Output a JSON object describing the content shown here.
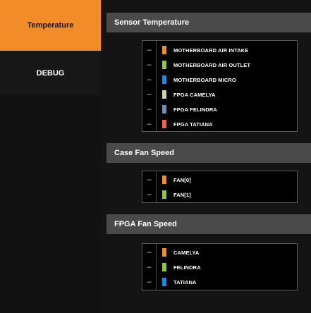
{
  "sidebar": {
    "items": [
      {
        "label": "Temperature"
      },
      {
        "label": "DEBUG"
      }
    ]
  },
  "sections": [
    {
      "title": "Sensor Temperature",
      "items": [
        {
          "label": "MOTHERBOARD AIR INTAKE",
          "color": "#f28c28",
          "toggle": "–"
        },
        {
          "label": "MOTHERBOARD AIR OUTLET",
          "color": "#8dc63f",
          "toggle": "–"
        },
        {
          "label": "MOTHERBOARD MICRO",
          "color": "#1e88e5",
          "toggle": "–"
        },
        {
          "label": "FPGA CAMELYA",
          "color": "#c9d6a0",
          "toggle": "–"
        },
        {
          "label": "FPGA FELINDRA",
          "color": "#6e8fb8",
          "toggle": "–"
        },
        {
          "label": "FPGA TATIANA",
          "color": "#f0663c",
          "toggle": "–"
        }
      ]
    },
    {
      "title": "Case Fan Speed",
      "items": [
        {
          "label": "FAN[0]",
          "color": "#f28c28",
          "toggle": "–"
        },
        {
          "label": "FAN[1]",
          "color": "#8dc63f",
          "toggle": "–"
        }
      ]
    },
    {
      "title": "FPGA Fan Speed",
      "items": [
        {
          "label": "CAMELYA",
          "color": "#f28c28",
          "toggle": "–"
        },
        {
          "label": "FELINDRA",
          "color": "#8dc63f",
          "toggle": "–"
        },
        {
          "label": "TATIANA",
          "color": "#1e88e5",
          "toggle": "–"
        }
      ]
    }
  ]
}
